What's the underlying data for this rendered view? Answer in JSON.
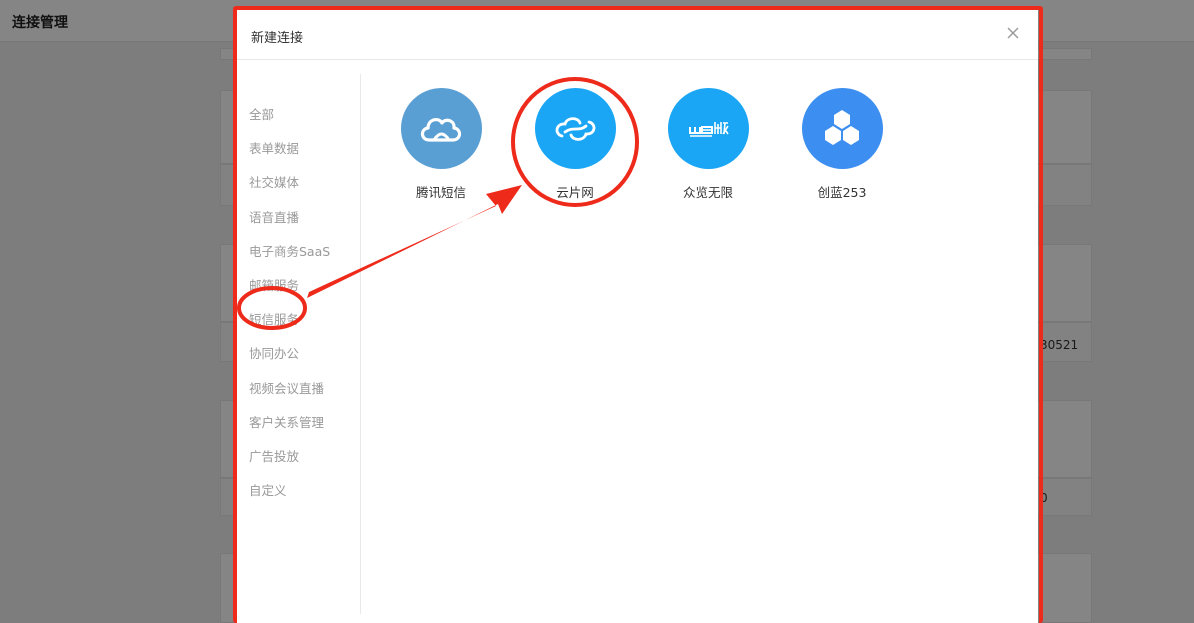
{
  "page": {
    "title": "连接管理",
    "partial_value": "30521",
    "partial_value_2": "0"
  },
  "modal": {
    "title": "新建连接",
    "close_icon": "close-icon"
  },
  "categories": [
    {
      "label": "全部"
    },
    {
      "label": "表单数据"
    },
    {
      "label": "社交媒体"
    },
    {
      "label": "语音直播"
    },
    {
      "label": "电子商务SaaS"
    },
    {
      "label": "邮箱服务"
    },
    {
      "label": "短信服务"
    },
    {
      "label": "协同办公"
    },
    {
      "label": "视频会议直播"
    },
    {
      "label": "客户关系管理"
    },
    {
      "label": "广告投放"
    },
    {
      "label": "自定义"
    }
  ],
  "apps": [
    {
      "label": "腾讯短信",
      "icon": "cloud-icon",
      "color": "#5a9fd3"
    },
    {
      "label": "云片网",
      "icon": "yunpian-icon",
      "color": "#1aa6f4"
    },
    {
      "label": "众览无限",
      "icon": "weiwei-icon",
      "color": "#1aa6f4"
    },
    {
      "label": "创蓝253",
      "icon": "cube-icon",
      "color": "#3c8ef0"
    }
  ],
  "annotation": {
    "color": "#ee2a1b"
  }
}
